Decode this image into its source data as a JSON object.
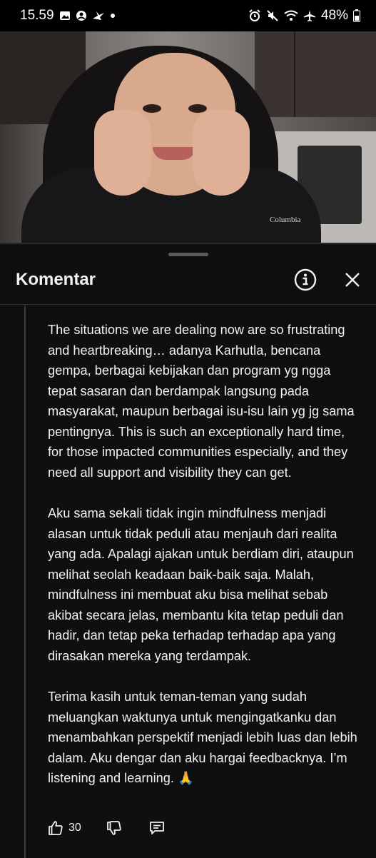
{
  "status_bar": {
    "time": "15.59",
    "battery": "48%"
  },
  "video": {
    "shirt_logo": "Columbia"
  },
  "comments_panel": {
    "title": "Komentar",
    "info_icon": "info-icon",
    "close_icon": "close-icon"
  },
  "comment": {
    "paragraphs": [
      "The situations we are dealing now are so frustrating and heartbreaking… adanya Karhutla, bencana gempa, berbagai kebijakan dan program yg ngga tepat sasaran dan berdampak langsung pada masyarakat, maupun berbagai isu-isu lain yg jg sama pentingnya. This is such an exceptionally hard time, for those impacted communities especially, and they need all support and visibility they can get.",
      "Aku sama sekali tidak ingin mindfulness menjadi alasan untuk tidak peduli atau menjauh dari realita yang ada. Apalagi ajakan untuk berdiam diri, ataupun melihat seolah keadaan baik-baik saja. Malah, mindfulness ini membuat aku bisa melihat sebab akibat secara jelas, membantu kita tetap peduli dan hadir, dan tetap peka terhadap terhadap apa yang dirasakan mereka yang terdampak.",
      "Terima kasih untuk teman-teman yang sudah meluangkan waktunya untuk mengingatkanku dan menambahkan perspektif menjadi lebih luas dan lebih dalam. Aku dengar dan aku hargai feedbacknya. I’m listening and learning. 🙏"
    ],
    "like_count": "30",
    "icons": [
      "thumbs-up-icon",
      "thumbs-down-icon",
      "reply-icon"
    ]
  },
  "colors": {
    "background": "#0f0f0f",
    "text": "#f1f1f1",
    "divider": "#2e2e2e"
  }
}
